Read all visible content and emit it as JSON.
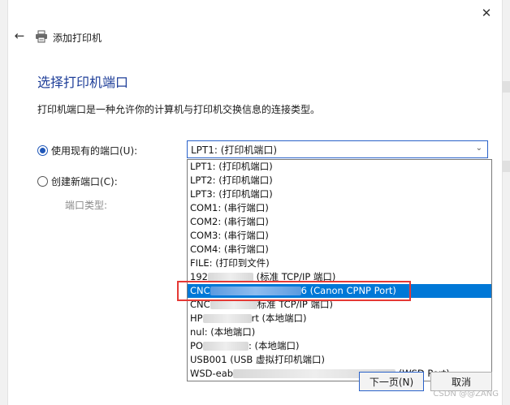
{
  "dialog": {
    "title": "添加打印机",
    "close_label": "✕",
    "back_label": "←"
  },
  "page": {
    "heading": "选择打印机端口",
    "description": "打印机端口是一种允许你的计算机与打印机交换信息的连接类型。"
  },
  "options": {
    "use_existing_label": "使用现有的端口(U):",
    "create_new_label": "创建新端口(C):",
    "port_type_label": "端口类型:"
  },
  "select": {
    "current_value": "LPT1: (打印机端口)"
  },
  "dropdown_items": [
    {
      "text": "LPT1: (打印机端口)"
    },
    {
      "text": "LPT2: (打印机端口)"
    },
    {
      "text": "LPT3: (打印机端口)"
    },
    {
      "text": "COM1: (串行端口)"
    },
    {
      "text": "COM2: (串行端口)"
    },
    {
      "text": "COM3: (串行端口)"
    },
    {
      "text": "COM4: (串行端口)"
    },
    {
      "text": "FILE: (打印到文件)"
    },
    {
      "prefix": "192",
      "suffix": " (标准 TCP/IP 端口)"
    },
    {
      "prefix": "CNC",
      "suffix": "6 (Canon CPNP Port)"
    },
    {
      "prefix": "CNC",
      "suffix": "标准 TCP/IP 端口)"
    },
    {
      "prefix": "HP",
      "suffix": "rt (本地端口)"
    },
    {
      "text": "nul: (本地端口)"
    },
    {
      "prefix": "PO",
      "suffix": ": (本地端口)"
    },
    {
      "text": "USB001 (USB 虚拟打印机端口)"
    },
    {
      "prefix": "WSD-eab",
      "suffix": " (WSD Port)"
    }
  ],
  "buttons": {
    "next_label": "下一页(N)",
    "cancel_label": "取消"
  },
  "watermark": "CSDN @@ZANG",
  "colors": {
    "heading": "#1f3f99",
    "selection": "#0078d7",
    "annotation": "#e53935"
  }
}
